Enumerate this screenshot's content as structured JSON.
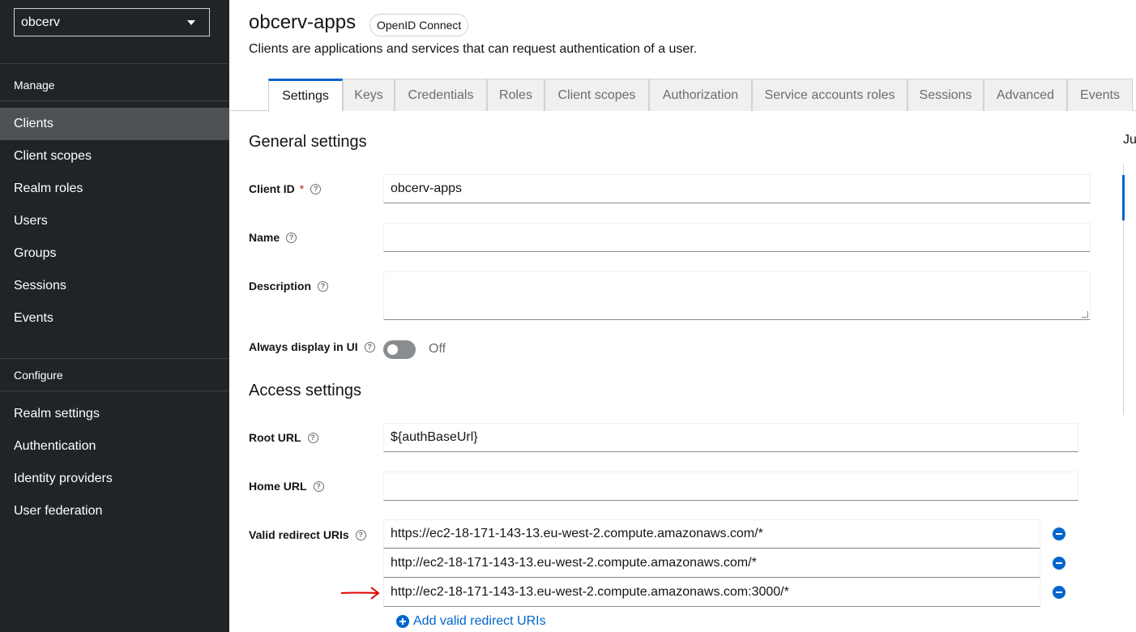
{
  "sidebar": {
    "realm": "obcerv",
    "manage_title": "Manage",
    "manage_items": [
      {
        "label": "Clients",
        "active": true
      },
      {
        "label": "Client scopes"
      },
      {
        "label": "Realm roles"
      },
      {
        "label": "Users"
      },
      {
        "label": "Groups"
      },
      {
        "label": "Sessions"
      },
      {
        "label": "Events"
      }
    ],
    "configure_title": "Configure",
    "configure_items": [
      {
        "label": "Realm settings"
      },
      {
        "label": "Authentication"
      },
      {
        "label": "Identity providers"
      },
      {
        "label": "User federation"
      }
    ]
  },
  "header": {
    "title": "obcerv-apps",
    "badge": "OpenID Connect",
    "subtitle": "Clients are applications and services that can request authentication of a user."
  },
  "tabs": [
    "Settings",
    "Keys",
    "Credentials",
    "Roles",
    "Client scopes",
    "Authorization",
    "Service accounts roles",
    "Sessions",
    "Advanced",
    "Events"
  ],
  "active_tab": "Settings",
  "general": {
    "heading": "General settings",
    "client_id_label": "Client ID",
    "client_id_required": "*",
    "client_id_value": "obcerv-apps",
    "name_label": "Name",
    "name_value": "",
    "description_label": "Description",
    "description_value": "",
    "always_display_label": "Always display in UI",
    "always_display_state": "Off"
  },
  "access": {
    "heading": "Access settings",
    "root_url_label": "Root URL",
    "root_url_value": "${authBaseUrl}",
    "home_url_label": "Home URL",
    "home_url_value": "",
    "redirect_label": "Valid redirect URIs",
    "redirect_uris": [
      "https://ec2-18-171-143-13.eu-west-2.compute.amazonaws.com/*",
      "http://ec2-18-171-143-13.eu-west-2.compute.amazonaws.com/*",
      "http://ec2-18-171-143-13.eu-west-2.compute.amazonaws.com:3000/*"
    ],
    "add_redirect_label": "Add valid redirect URIs"
  },
  "jump_links": {
    "partial_text": "Ju"
  },
  "colors": {
    "sidebar_bg": "#212427",
    "active_nav_bg": "#4f5255",
    "accent": "#0066cc",
    "required": "#c9190b",
    "annotation_arrow": "#e00000"
  }
}
